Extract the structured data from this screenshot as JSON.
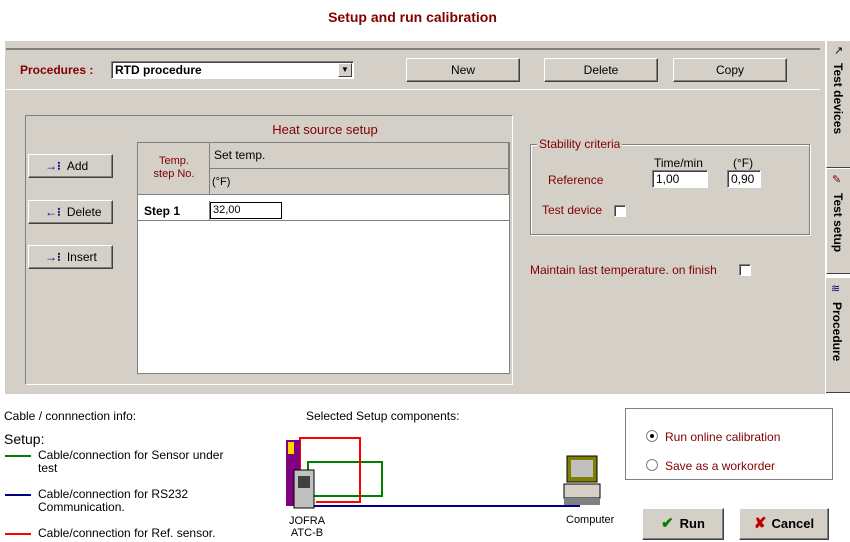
{
  "title": "Setup and run calibration",
  "procedures": {
    "label": "Procedures :",
    "selected": "RTD procedure",
    "new_label": "New",
    "delete_label": "Delete",
    "copy_label": "Copy"
  },
  "heat_source": {
    "title": "Heat source setup",
    "add_label": "Add",
    "delete_label": "Delete",
    "insert_label": "Insert",
    "col1_header_line1": "Temp.",
    "col1_header_line2": "step No.",
    "col2_header_line1": "Set temp.",
    "col2_header_line2": "(°F)",
    "rows": [
      {
        "step": "Step 1",
        "value": "32,00"
      }
    ]
  },
  "stability": {
    "legend": "Stability criteria",
    "time_header": "Time/min",
    "unit_header": "(°F)",
    "reference_label": "Reference",
    "reference_time": "1,00",
    "reference_temp": "0,90",
    "test_device_label": "Test device"
  },
  "maintain_label": "Maintain last temperature. on finish",
  "tabs": {
    "test_devices": "Test devices",
    "test_setup": "Test setup",
    "procedure": "Procedure"
  },
  "bottom": {
    "cable_info_label": "Cable / connnection info:",
    "setup_label": "Setup:",
    "selected_components_label": "Selected Setup components:",
    "legend_sensor": "Cable/connection for Sensor under test",
    "legend_rs232": "Cable/connection for RS232 Communication.",
    "legend_ref": "Cable/connection for Ref. sensor.",
    "device_name_line1": "JOFRA",
    "device_name_line2": "ATC-B",
    "computer_label": "Computer",
    "run_online_label": "Run online calibration",
    "save_workorder_label": "Save as a workorder",
    "run_label": "Run",
    "cancel_label": "Cancel"
  },
  "colors": {
    "accent_darkred": "#800000",
    "cable_sensor": "#008000",
    "cable_rs232": "#000080",
    "cable_ref": "#ff0000"
  }
}
